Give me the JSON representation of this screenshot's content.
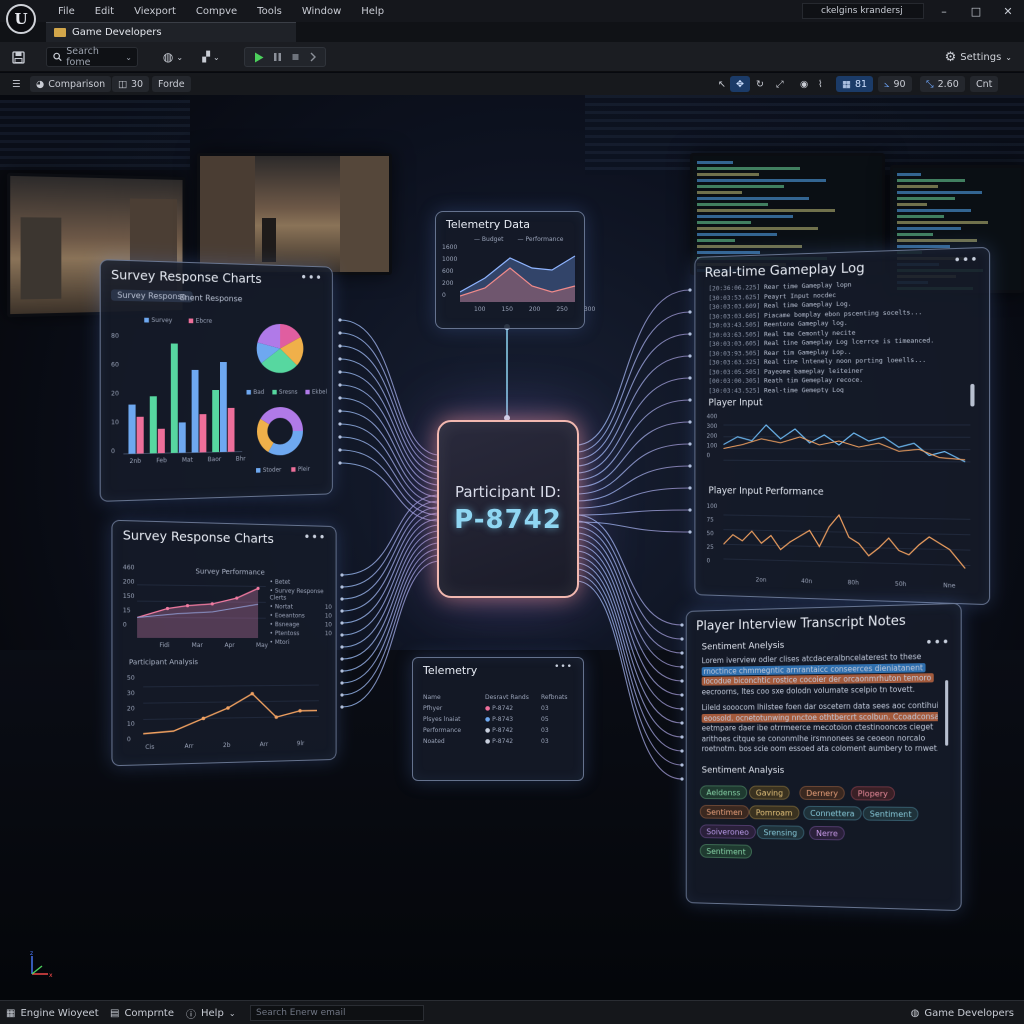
{
  "menu": {
    "logo_glyph": "U",
    "items": [
      "File",
      "Edit",
      "Viexport",
      "Compve",
      "Tools",
      "Window",
      "Help"
    ],
    "user": "ckelgins krandersj",
    "window_buttons": [
      "–",
      "□",
      "✕"
    ]
  },
  "tab": {
    "label": "Game Developers"
  },
  "toolbar": {
    "search_placeholder": "Search fome",
    "settings_label": "Settings"
  },
  "viewport_bar": {
    "comparison": "Comparison",
    "view_mode": "30",
    "forde": "Forde",
    "num_81": "81",
    "num_90": "90",
    "num_260": "2.60",
    "cnt": "Cnt"
  },
  "survey_top": {
    "title": "Survey Response Charts",
    "tabs": [
      "Survey Response",
      "Enent Response"
    ],
    "legend": [
      "Survey",
      "Ebcre"
    ],
    "y_ticks": [
      "80",
      "60",
      "20",
      "10",
      "0"
    ],
    "x_ticks": [
      "2nb",
      "Feb",
      "Mat",
      "Baor",
      "Bhr"
    ],
    "pie_legend": [
      "Bad",
      "Sresns",
      "Ekbel"
    ],
    "donut_legend": [
      "Stoder",
      "Pleir"
    ],
    "colors": {
      "blue": "#6ea8f0",
      "green": "#57d7a0",
      "pink": "#ee6f9a"
    }
  },
  "survey_bottom": {
    "title": "Survey Response Charts",
    "chart1_title": "Survey Performance",
    "y_ticks": [
      "460",
      "200",
      "150",
      "15",
      "0"
    ],
    "x_ticks": [
      "Fidi",
      "Mar",
      "Apr",
      "May"
    ],
    "legend": [
      "Betet",
      "Survey Response Clerts",
      "Nortat",
      "Eoeantons",
      "Bsneage",
      "Ptentoss",
      "Mtori"
    ],
    "legend_vals": [
      "",
      "",
      "10",
      "10",
      "10",
      "10",
      ""
    ],
    "chart2_title": "Participant Analysis",
    "chart2_y": [
      "50",
      "30",
      "20",
      "10",
      "0"
    ],
    "chart2_x": [
      "Cis",
      "Arr",
      "2b",
      "Arr",
      "9lr"
    ]
  },
  "telemetry_top": {
    "title": "Telemetry Data",
    "legend": [
      "Budget",
      "Performance"
    ],
    "y_ticks": [
      "1600",
      "1000",
      "600",
      "200",
      "0"
    ],
    "x_ticks": [
      "100",
      "150",
      "200",
      "250",
      "300"
    ]
  },
  "core": {
    "label": "Participant ID:",
    "id": "P-8742"
  },
  "telemetry_bottom": {
    "title": "Telemetry",
    "headers": [
      "Name",
      "Desravt Rands",
      "Refbnats"
    ],
    "rows": [
      {
        "name": "Pfhyer",
        "id": "P-8742",
        "val": "03"
      },
      {
        "name": "Plsyes lnaiat",
        "id": "P-8743",
        "val": "05"
      },
      {
        "name": "Performance",
        "id": "P-8742",
        "val": "03"
      },
      {
        "name": "Noated",
        "id": "P-8742",
        "val": "03"
      }
    ]
  },
  "gameplay": {
    "title": "Real-time Gameplay Log",
    "log": [
      {
        "ts": "[20:36:06.225]",
        "msg": "Rear time Gameplay lopn"
      },
      {
        "ts": "[30:03:53.625]",
        "msg": "Peayrt Input nocdec"
      },
      {
        "ts": "[30:03:03.609]",
        "msg": "Real time Gameplay Log."
      },
      {
        "ts": "[30:03:03.605]",
        "msg": "Piacame bomplay ebon pscenting socelts..."
      },
      {
        "ts": "[30:03:43.505]",
        "msg": "Reentone Gameplay log."
      },
      {
        "ts": "[30:03:63.505]",
        "msg": "Real tme Cemontly necite"
      },
      {
        "ts": "[30:03:03.605]",
        "msg": "Real tine Gameplay Log lcerrce is timeanced."
      },
      {
        "ts": "[30:03:93.505]",
        "msg": "Rear tim Gameplay Lop.."
      },
      {
        "ts": "[30:03:63.325]",
        "msg": "Real tine lntenely noon porting loeells..."
      },
      {
        "ts": "[30:03:05.505]",
        "msg": "Payeome bameplay leiteiner"
      },
      {
        "ts": "[00:03:00.305]",
        "msg": "Reath tim Gemeplay recoce."
      },
      {
        "ts": "[30:03:43.525]",
        "msg": "Real-time Gemepty Log"
      }
    ],
    "input_title": "Player Input",
    "input_y": [
      "400",
      "300",
      "200",
      "100",
      "0"
    ],
    "perf_title": "Player Input Performance",
    "perf_y": [
      "100",
      "75",
      "50",
      "25",
      "0"
    ],
    "perf_x": [
      "2on",
      "40n",
      "80h",
      "50h",
      "Nne"
    ],
    "colors": {
      "blue": "#6bb6ef",
      "orange": "#f0a060"
    }
  },
  "interview": {
    "title": "Player Interview Transcript Notes",
    "section1": "Sentiment Anelysis",
    "lines": [
      "Lorem iverview odler clises atcdaceralbncelaterest to these",
      "rnoctince chmmegntic arnrantaicc conseerces dieniatanent",
      "locodue biconchtic rostice cocoier der orcaonmrhuton temoro",
      "eecroorns, ltes coo sxe dolodn volumate scelpio tn tovett.",
      "Lileld sooocom lhilstee foen dar oscetern data sees aoc contihuill",
      "eoosold. ocnetotunwing nnctoe othtbercrt scolbun. Ccoadconsa",
      "eetmpare daer ibe otrrmeerce mecotoion ctestinooncos cieget",
      "arithoes citque se cononmlhe irsmnonees se ceoeon norcalo",
      "roetnotm. bos scie oom essoed ata coloment aumbery to rnwet."
    ],
    "section2": "Sentiment Analysis",
    "tags": [
      "Aeldenss",
      "Gaving",
      "Dernery",
      "Plopery",
      "Sentimen",
      "Pomroam",
      "Connettera",
      "Sentiment",
      "Soiveroneo",
      "Srensing",
      "Nerre",
      "Sentiment"
    ]
  },
  "status": {
    "left": "Engine Wioyeet",
    "compute": "Comprnte",
    "help": "Help",
    "search_placeholder": "Search Enerw email",
    "right": "Game Developers"
  }
}
